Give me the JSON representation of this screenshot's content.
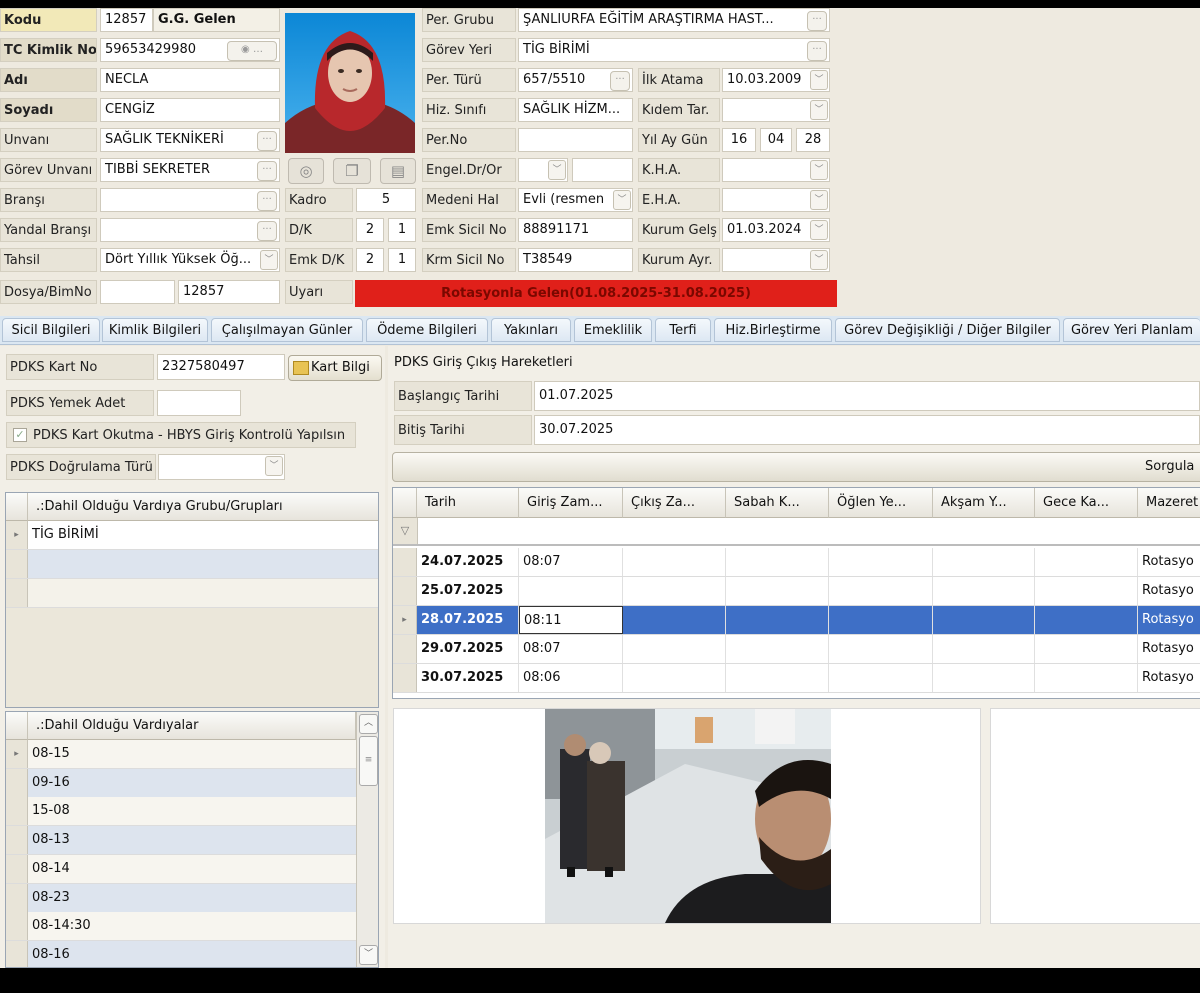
{
  "top": {
    "kodu_label": "Kodu",
    "kodu_value": "12857",
    "kodu_status": "G.G. Gelen",
    "tc_label": "TC Kimlik No",
    "tc_value": "59653429980",
    "adi_label": "Adı",
    "adi_value": "NECLA",
    "soyadi_label": "Soyadı",
    "soyadi_value": "CENGİZ",
    "unvani_label": "Unvanı",
    "unvani_value": "SAĞLIK TEKNİKERİ",
    "gorev_unvani_label": "Görev Unvanı",
    "gorev_unvani_value": "TIBBİ SEKRETER",
    "bransi_label": "Branşı",
    "bransi_value": "",
    "yandal_label": "Yandal Branşı",
    "yandal_value": "",
    "tahsil_label": "Tahsil",
    "tahsil_value": "Dört Yıllık Yüksek Öğ...",
    "dosya_label": "Dosya/BimNo",
    "dosya_value1": "",
    "dosya_value2": "12857",
    "kadro_label": "Kadro",
    "kadro_value": "5",
    "dk_label": "D/K",
    "dk_v1": "2",
    "dk_v2": "1",
    "emkdk_label": "Emk D/K",
    "emkdk_v1": "2",
    "emkdk_v2": "1",
    "uyari_label": "Uyarı",
    "uyari_text": "Rotasyonla Gelen(01.08.2025-31.08.2025)",
    "per_grubu_label": "Per. Grubu",
    "per_grubu_value": "ŞANLIURFA EĞİTİM ARAŞTIRMA HAST...",
    "gorev_yeri_label": "Görev Yeri",
    "gorev_yeri_value": "TİG BİRİMİ",
    "per_turu_label": "Per. Türü",
    "per_turu_value": "657/5510",
    "hiz_sinifi_label": "Hiz. Sınıfı",
    "hiz_sinifi_value": "SAĞLIK HİZM...",
    "per_no_label": "Per.No",
    "per_no_value": "",
    "engel_label": "Engel.Dr/Or",
    "engel_value": "",
    "medeni_label": "Medeni Hal",
    "medeni_value": "Evli (resmen",
    "emk_sicil_label": "Emk Sicil No",
    "emk_sicil_value": "88891171",
    "krm_sicil_label": "Krm Sicil No",
    "krm_sicil_value": "T38549",
    "ilk_atama_label": "İlk Atama",
    "ilk_atama_value": "10.03.2009",
    "kidem_label": "Kıdem Tar.",
    "kidem_value": "",
    "yilaygun_label": "Yıl Ay Gün",
    "yil": "16",
    "ay": "04",
    "gun": "28",
    "kha_label": "K.H.A.",
    "kha_value": "",
    "eha_label": "E.H.A.",
    "eha_value": "",
    "kurum_gels_label": "Kurum Gelş",
    "kurum_gels_value": "01.03.2024",
    "kurum_ayr_label": "Kurum Ayr.",
    "kurum_ayr_value": ""
  },
  "tabs": [
    "Sicil Bilgileri",
    "Kimlik Bilgileri",
    "Çalışılmayan Günler",
    "Ödeme Bilgileri",
    "Yakınları",
    "Emeklilik",
    "Terfi",
    "Hiz.Birleştirme",
    "Görev Değişikliği / Diğer Bilgiler",
    "Görev Yeri Planlam"
  ],
  "left": {
    "kart_no_label": "PDKS Kart No",
    "kart_no_value": "2327580497",
    "kart_bilgi_button": "Kart Bilgi",
    "yemek_label": "PDKS Yemek Adet",
    "yemek_value": "",
    "okutma_label": "PDKS Kart Okutma - HBYS Giriş Kontrolü Yapılsın",
    "dogrulama_label": "PDKS Doğrulama Türü",
    "dogrulama_value": "",
    "vardiya_grubu_header": ".:Dahil Olduğu Vardıya Grubu/Grupları",
    "vardiya_grubu_rows": [
      "TİG BİRİMİ",
      "",
      ""
    ],
    "vardiyalar_header": ".:Dahil Olduğu Vardıyalar",
    "vardiyalar_rows": [
      "08-15",
      "09-16",
      "15-08",
      "08-13",
      "08-14",
      "08-23",
      "08-14:30",
      "08-16"
    ]
  },
  "right": {
    "section_title": "PDKS Giriş Çıkış Hareketleri",
    "baslangic_label": "Başlangıç Tarihi",
    "baslangic_value": "01.07.2025",
    "bitis_label": "Bitiş Tarihi",
    "bitis_value": "30.07.2025",
    "sorgula_button": "Sorgula",
    "columns": [
      "Tarih",
      "Giriş Zam...",
      "Çıkış Za...",
      "Sabah K...",
      "Öğlen Ye...",
      "Akşam Y...",
      "Gece Ka...",
      "Mazeret"
    ],
    "rows": [
      {
        "tarih": "24.07.2025",
        "giris": "08:07",
        "mazeret": "Rotasyo"
      },
      {
        "tarih": "25.07.2025",
        "giris": "",
        "mazeret": "Rotasyo"
      },
      {
        "tarih": "28.07.2025",
        "giris": "08:11",
        "mazeret": "Rotasyo"
      },
      {
        "tarih": "29.07.2025",
        "giris": "08:07",
        "mazeret": "Rotasyo"
      },
      {
        "tarih": "30.07.2025",
        "giris": "08:06",
        "mazeret": "Rotasyo"
      }
    ],
    "selected_row": 2
  },
  "colors": {
    "accent_selection": "#3e6fc6",
    "warning_red": "#e0201a",
    "tab_blue": "#dbe7f2"
  }
}
